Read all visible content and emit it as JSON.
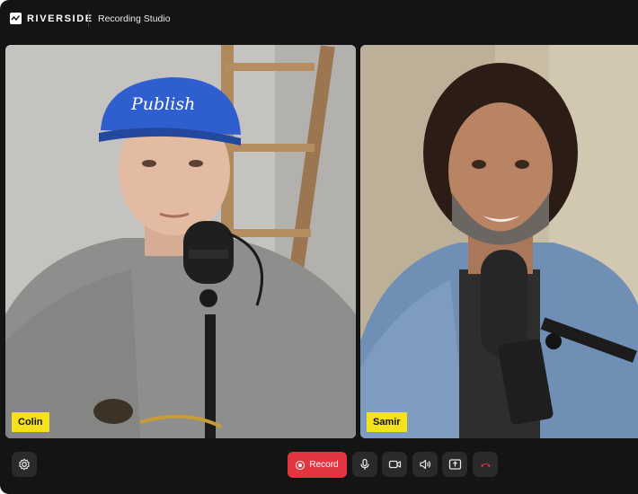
{
  "app": {
    "brand": "RIVERSIDE",
    "title": "Recording Studio"
  },
  "participants": [
    {
      "name": "Colin"
    },
    {
      "name": "Samir"
    }
  ],
  "toolbar": {
    "record_label": "Record",
    "icons": [
      "gear-icon",
      "record-icon",
      "microphone-icon",
      "camera-icon",
      "speaker-icon",
      "share-screen-icon",
      "end-call-icon"
    ]
  },
  "colors": {
    "background": "#141414",
    "record": "#e2353f",
    "name_tag": "#f5e11c",
    "end_call": "#e2353f"
  }
}
